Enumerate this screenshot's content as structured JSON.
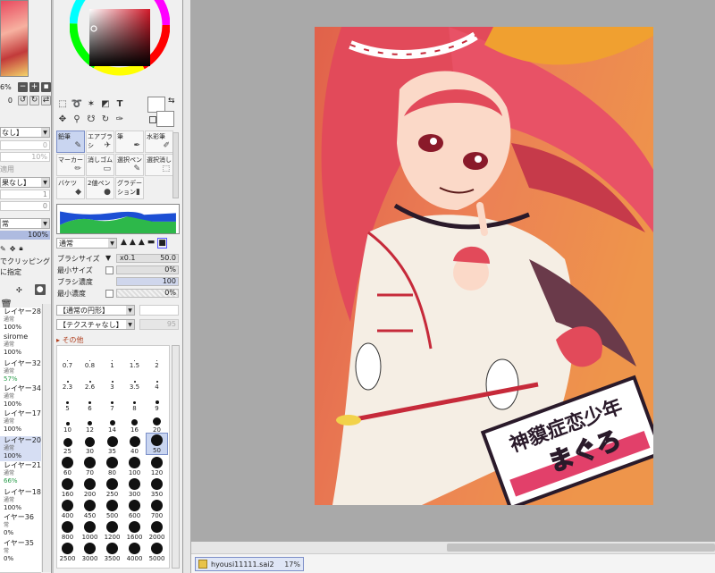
{
  "left_panel": {
    "zoom_value": "6%",
    "angle_value": "0",
    "blend1": "なし】",
    "opacity_grey1": "0",
    "opacity_grey2": "10%",
    "apply_text": "適用",
    "blend2": "果なし】",
    "num1": "1",
    "num2": "0",
    "mode_select": "常",
    "opacity": "100%",
    "clip_line1": "でクリッピング",
    "clip_line2": "に指定",
    "layers": [
      {
        "name": "レイヤー28",
        "mode": "通常",
        "opacity": "100%",
        "green": false,
        "selected": false
      },
      {
        "name": "sirome",
        "mode": "通常",
        "opacity": "100%",
        "green": false,
        "selected": false
      },
      {
        "name": "レイヤー32",
        "mode": "通常",
        "opacity": "57%",
        "green": true,
        "selected": false
      },
      {
        "name": "レイヤー34",
        "mode": "通常",
        "opacity": "100%",
        "green": false,
        "selected": false
      },
      {
        "name": "レイヤー17",
        "mode": "通常",
        "opacity": "100%",
        "green": false,
        "selected": false
      },
      {
        "name": "レイヤー20",
        "mode": "通常",
        "opacity": "100%",
        "green": false,
        "selected": true
      },
      {
        "name": "レイヤー21",
        "mode": "通常",
        "opacity": "66%",
        "green": true,
        "selected": false
      },
      {
        "name": "レイヤー18",
        "mode": "通常",
        "opacity": "100%",
        "green": false,
        "selected": false
      },
      {
        "name": "イヤー36",
        "mode": "常",
        "opacity": "0%",
        "green": false,
        "selected": false
      },
      {
        "name": "イヤー35",
        "mode": "常",
        "opacity": "0%",
        "green": false,
        "selected": false
      }
    ]
  },
  "tools": {
    "brushes": [
      {
        "label": "鉛筆",
        "glyph": "✎",
        "selected": true
      },
      {
        "label": "エアブラシ",
        "glyph": "✈",
        "selected": false
      },
      {
        "label": "筆",
        "glyph": "✒",
        "selected": false
      },
      {
        "label": "水彩筆",
        "glyph": "✐",
        "selected": false
      },
      {
        "label": "マーカー",
        "glyph": "✏",
        "selected": false
      },
      {
        "label": "消しゴム",
        "glyph": "▭",
        "selected": false
      },
      {
        "label": "選択ペン",
        "glyph": "✎",
        "selected": false
      },
      {
        "label": "選択消し",
        "glyph": "⬚",
        "selected": false
      },
      {
        "label": "バケツ",
        "glyph": "◆",
        "selected": false
      },
      {
        "label": "2値ペン",
        "glyph": "●",
        "selected": false
      },
      {
        "label": "グラデーション",
        "glyph": "▮",
        "selected": false
      }
    ],
    "blend_mode": "通常",
    "brush_size_label": "ブラシサイズ",
    "brush_size_mult": "x0.1",
    "brush_size_value": "50.0",
    "min_size_label": "最小サイズ",
    "min_size_value": "0%",
    "density_label": "ブラシ濃度",
    "density_value": "100",
    "min_density_label": "最小濃度",
    "min_density_value": "0%",
    "shape_select": "【通常の円形】",
    "texture_select": "【テクスチャなし】",
    "texture_value": "95",
    "other_label": "その他",
    "sizes": [
      {
        "label": "0.7",
        "d": 1
      },
      {
        "label": "0.8",
        "d": 1
      },
      {
        "label": "1",
        "d": 1
      },
      {
        "label": "1.5",
        "d": 1
      },
      {
        "label": "2",
        "d": 1
      },
      {
        "label": "2.3",
        "d": 2
      },
      {
        "label": "2.6",
        "d": 2
      },
      {
        "label": "3",
        "d": 2
      },
      {
        "label": "3.5",
        "d": 2
      },
      {
        "label": "4",
        "d": 2
      },
      {
        "label": "5",
        "d": 3
      },
      {
        "label": "6",
        "d": 3
      },
      {
        "label": "7",
        "d": 3
      },
      {
        "label": "8",
        "d": 3
      },
      {
        "label": "9",
        "d": 4
      },
      {
        "label": "10",
        "d": 4
      },
      {
        "label": "12",
        "d": 5
      },
      {
        "label": "14",
        "d": 6
      },
      {
        "label": "16",
        "d": 7
      },
      {
        "label": "20",
        "d": 9
      },
      {
        "label": "25",
        "d": 10
      },
      {
        "label": "30",
        "d": 11
      },
      {
        "label": "35",
        "d": 12
      },
      {
        "label": "40",
        "d": 12
      },
      {
        "label": "50",
        "d": 13
      },
      {
        "label": "60",
        "d": 13
      },
      {
        "label": "70",
        "d": 13
      },
      {
        "label": "80",
        "d": 13
      },
      {
        "label": "100",
        "d": 13
      },
      {
        "label": "120",
        "d": 13
      },
      {
        "label": "160",
        "d": 13
      },
      {
        "label": "200",
        "d": 13
      },
      {
        "label": "250",
        "d": 13
      },
      {
        "label": "300",
        "d": 13
      },
      {
        "label": "350",
        "d": 13
      },
      {
        "label": "400",
        "d": 13
      },
      {
        "label": "450",
        "d": 13
      },
      {
        "label": "500",
        "d": 13
      },
      {
        "label": "600",
        "d": 13
      },
      {
        "label": "700",
        "d": 13
      },
      {
        "label": "800",
        "d": 13
      },
      {
        "label": "1000",
        "d": 13
      },
      {
        "label": "1200",
        "d": 13
      },
      {
        "label": "1600",
        "d": 13
      },
      {
        "label": "2000",
        "d": 13
      },
      {
        "label": "2500",
        "d": 13
      },
      {
        "label": "3000",
        "d": 13
      },
      {
        "label": "3500",
        "d": 13
      },
      {
        "label": "4000",
        "d": 13
      },
      {
        "label": "5000",
        "d": 13
      }
    ],
    "selected_size": "50"
  },
  "document": {
    "filename": "hyousi11111.sai2",
    "zoom": "17%"
  },
  "artwork": {
    "title_line1": "神貘症恋少年",
    "title_line2": "まぐろ"
  },
  "colors": {
    "accent_select": "#c9d5f0",
    "background": "#a9a9a9"
  }
}
